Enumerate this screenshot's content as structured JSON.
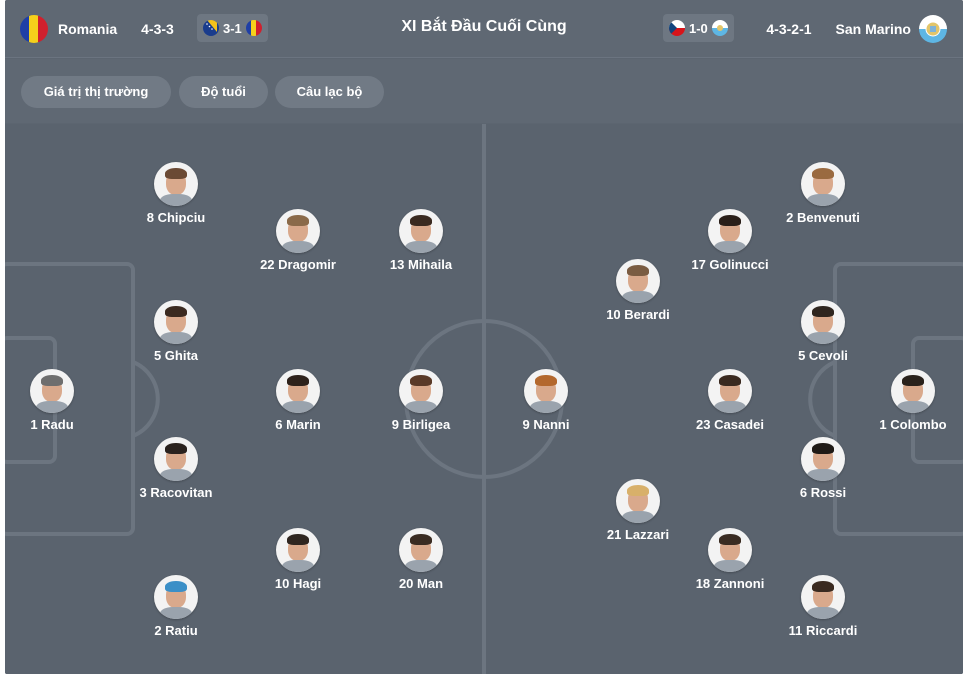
{
  "header": {
    "title": "XI Bắt Đầu Cuối Cùng",
    "home": {
      "name": "Romania",
      "formation": "4-3-3",
      "flag_icon": "romania-flag-icon",
      "recent_score": "3-1"
    },
    "away": {
      "name": "San Marino",
      "formation": "4-3-2-1",
      "flag_icon": "san-marino-flag-icon",
      "recent_score": "1-0"
    }
  },
  "filters": [
    "Giá trị thị trường",
    "Độ tuổi",
    "Câu lạc bộ"
  ],
  "colors": {
    "card": "#5c6570",
    "pitch": "#5a636e",
    "lines": "#6c7580",
    "chip": "#717a85"
  },
  "home_players": [
    {
      "label": "8 Chipciu",
      "hair": "#6b4a34"
    },
    {
      "label": "22 Dragomir",
      "hair": "#8a6a4a"
    },
    {
      "label": "13 Mihaila",
      "hair": "#3a2a20"
    },
    {
      "label": "5 Ghita",
      "hair": "#3b2a20"
    },
    {
      "label": "1 Radu",
      "hair": "#6e6e6e"
    },
    {
      "label": "6 Marin",
      "hair": "#2e221b"
    },
    {
      "label": "9 Birligea",
      "hair": "#5a3a28"
    },
    {
      "label": "3 Racovitan",
      "hair": "#2a221e"
    },
    {
      "label": "10 Hagi",
      "hair": "#2f2620"
    },
    {
      "label": "20 Man",
      "hair": "#3a2c22"
    },
    {
      "label": "2 Ratiu",
      "hair": "#3b8fc7"
    }
  ],
  "away_players": [
    {
      "label": "2 Benvenuti",
      "hair": "#9a6a40"
    },
    {
      "label": "17 Golinucci",
      "hair": "#2a1f19"
    },
    {
      "label": "10 Berardi",
      "hair": "#7a5c42"
    },
    {
      "label": "5 Cevoli",
      "hair": "#2f261f"
    },
    {
      "label": "9 Nanni",
      "hair": "#b3682e"
    },
    {
      "label": "23 Casadei",
      "hair": "#3a2a20"
    },
    {
      "label": "1 Colombo",
      "hair": "#2a221c"
    },
    {
      "label": "6 Rossi",
      "hair": "#1f1a16"
    },
    {
      "label": "21 Lazzari",
      "hair": "#d8b06a"
    },
    {
      "label": "18 Zannoni",
      "hair": "#3a2c22"
    },
    {
      "label": "11 Riccardi",
      "hair": "#3a2a20"
    }
  ]
}
